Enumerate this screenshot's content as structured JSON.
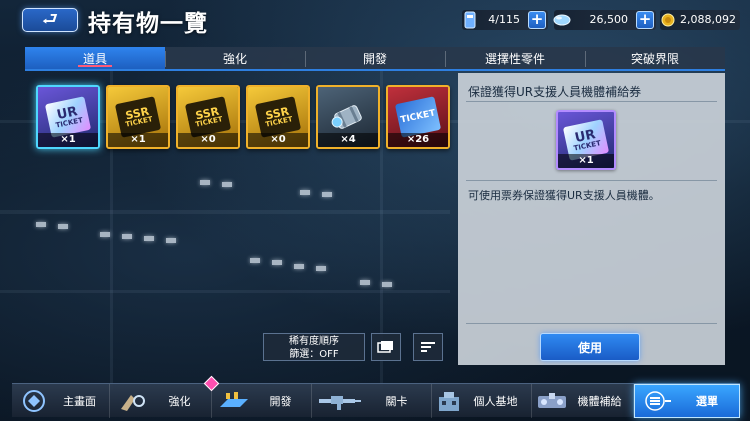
{
  "header": {
    "back_glyph": "⮐",
    "title": "持有物一覽",
    "resources": [
      {
        "icon": "mobile-suit-slot-icon",
        "value": "4/115",
        "has_plus": true
      },
      {
        "icon": "capsule-icon",
        "value": "26,500",
        "has_plus": true
      },
      {
        "icon": "gold-coin-icon",
        "value": "2,088,092",
        "has_plus": false
      }
    ]
  },
  "tabs": [
    "道具",
    "強化",
    "開發",
    "選擇性零件",
    "突破界限"
  ],
  "active_tab": 0,
  "items": [
    {
      "name": "ur-support-ticket",
      "label": "UR",
      "sub": "TICKET",
      "count": "×1",
      "selected": true,
      "bg": "#3b2f8f",
      "border": "#b38cff"
    },
    {
      "name": "ssr-ticket-a",
      "label": "SSR",
      "sub": "TICKET",
      "count": "×1",
      "selected": false,
      "bg": "#c89a12",
      "border": "#f0b12a"
    },
    {
      "name": "ssr-ticket-b",
      "label": "SSR",
      "sub": "TICKET",
      "count": "×0",
      "selected": false,
      "bg": "#c89a12",
      "border": "#f0b12a"
    },
    {
      "name": "ssr-ticket-c",
      "label": "SSR",
      "sub": "TICKET",
      "count": "×0",
      "selected": false,
      "bg": "#c89a12",
      "border": "#f0b12a"
    },
    {
      "name": "part-canister",
      "label": "",
      "sub": "",
      "count": "×4",
      "selected": false,
      "bg": "#3a4a5a",
      "border": "#f0b12a"
    },
    {
      "name": "red-ticket",
      "label": "TICKET",
      "sub": "",
      "count": "×26",
      "selected": false,
      "bg": "#8a1e2a",
      "border": "#f0b12a"
    }
  ],
  "detail": {
    "title": "保證獲得UR支援人員機體補給券",
    "count": "×1",
    "ticket_label": "UR",
    "ticket_sub": "TICKET",
    "description": "可使用票券保證獲得UR支援人員機體。",
    "use_button": "使用"
  },
  "sort": {
    "line1": "稀有度順序",
    "line2": "篩選：OFF"
  },
  "nav": [
    {
      "name": "nav-home",
      "icon": "home-emblem-icon",
      "label": "主畫面",
      "width": 98,
      "active": false,
      "badge": false
    },
    {
      "name": "nav-enhance",
      "icon": "enhance-tools-icon",
      "label": "強化",
      "width": 102,
      "active": false,
      "badge": true
    },
    {
      "name": "nav-develop",
      "icon": "develop-platform-icon",
      "label": "開發",
      "width": 100,
      "active": false,
      "badge": false
    },
    {
      "name": "nav-stage",
      "icon": "rifle-icon",
      "label": "關卡",
      "width": 120,
      "active": false,
      "badge": false
    },
    {
      "name": "nav-base",
      "icon": "base-building-icon",
      "label": "個人基地",
      "width": 100,
      "active": false,
      "badge": false
    },
    {
      "name": "nav-supply",
      "icon": "supply-crate-icon",
      "label": "機體補給",
      "width": 102,
      "active": false,
      "badge": false
    },
    {
      "name": "nav-menu",
      "icon": "menu-icon",
      "label": "選單",
      "width": 106,
      "active": true,
      "badge": false
    }
  ]
}
